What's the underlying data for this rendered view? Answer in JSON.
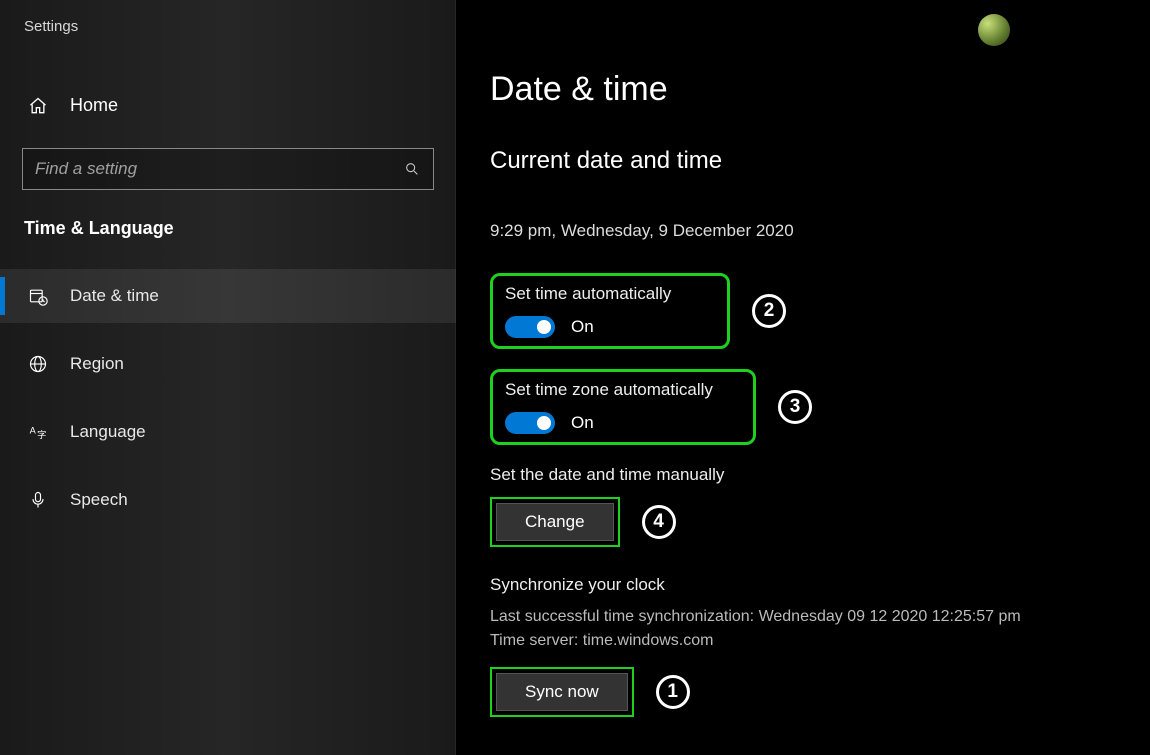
{
  "app": {
    "header": "Settings"
  },
  "sidebar": {
    "home_label": "Home",
    "search_placeholder": "Find a setting",
    "category_title": "Time & Language",
    "items": [
      {
        "key": "date-time",
        "label": "Date & time",
        "active": true
      },
      {
        "key": "region",
        "label": "Region",
        "active": false
      },
      {
        "key": "language",
        "label": "Language",
        "active": false
      },
      {
        "key": "speech",
        "label": "Speech",
        "active": false
      }
    ]
  },
  "main": {
    "page_title": "Date & time",
    "current_section_title": "Current date and time",
    "current_datetime": "9:29 pm, Wednesday, 9 December 2020",
    "set_time_auto": {
      "label": "Set time automatically",
      "state_label": "On"
    },
    "set_tz_auto": {
      "label": "Set time zone automatically",
      "state_label": "On"
    },
    "set_manual": {
      "label": "Set the date and time manually",
      "button": "Change"
    },
    "sync": {
      "heading": "Synchronize your clock",
      "last_sync": "Last successful time synchronization: Wednesday 09 12 2020 12:25:57 pm",
      "server": "Time server: time.windows.com",
      "button": "Sync now"
    }
  },
  "annotations": {
    "sync_now": "1",
    "set_time_auto": "2",
    "set_tz_auto": "3",
    "change": "4"
  }
}
